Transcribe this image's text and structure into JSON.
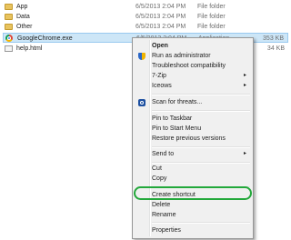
{
  "files": [
    {
      "name": "App",
      "date": "6/5/2013 2:04 PM",
      "type": "File folder",
      "size": "",
      "icon": "folder-icon"
    },
    {
      "name": "Data",
      "date": "6/5/2013 2:04 PM",
      "type": "File folder",
      "size": "",
      "icon": "folder-icon"
    },
    {
      "name": "Other",
      "date": "6/5/2013 2:04 PM",
      "type": "File folder",
      "size": "",
      "icon": "folder-icon"
    },
    {
      "name": "GoogleChrome.exe",
      "date": "6/5/2013 2:04 PM",
      "type": "Application",
      "size": "353 KB",
      "icon": "chrome-icon"
    },
    {
      "name": "help.html",
      "date": "",
      "type": "",
      "size": "34 KB",
      "icon": "html-file-icon"
    }
  ],
  "context_menu": {
    "items": [
      {
        "label": "Open",
        "bold": true
      },
      {
        "label": "Run as administrator",
        "icon": "shield-icon"
      },
      {
        "label": "Troubleshoot compatibility"
      },
      {
        "label": "7-Zip",
        "submenu": true
      },
      {
        "label": "Iceows",
        "submenu": true
      },
      {
        "label": "Scan for threats...",
        "icon": "scan-icon"
      },
      {
        "label": "Pin to Taskbar"
      },
      {
        "label": "Pin to Start Menu"
      },
      {
        "label": "Restore previous versions"
      },
      {
        "label": "Send to",
        "submenu": true
      },
      {
        "label": "Cut"
      },
      {
        "label": "Copy"
      },
      {
        "label": "Create shortcut",
        "highlighted": true
      },
      {
        "label": "Delete"
      },
      {
        "label": "Rename"
      },
      {
        "label": "Properties"
      }
    ],
    "submenu_arrow": "▸"
  },
  "colors": {
    "selection_bg": "#cde6f7",
    "highlight_ring": "#22a83a",
    "menu_bg": "#f0f0f0"
  }
}
